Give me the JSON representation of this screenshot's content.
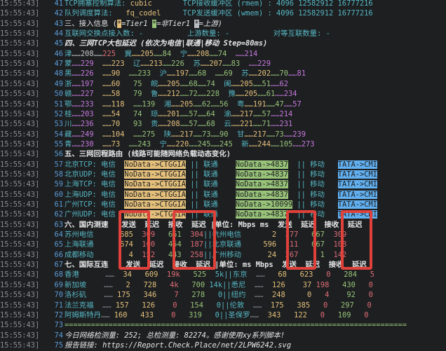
{
  "lines": [
    {
      "ts": "15:55:43]",
      "n": "41",
      "segs": [
        [
          "TCP拥塞控制算法: ",
          "cyan"
        ],
        [
          "cubic",
          "yellow"
        ],
        [
          "       TCP接收缓冲区 (rmem) : 4096 12582912 16777216",
          "cyan"
        ]
      ]
    },
    {
      "ts": "15:55:43]",
      "n": "42",
      "segs": [
        [
          "队列调度算法:   ",
          "cyan"
        ],
        [
          "fq_codel",
          "yellow"
        ],
        [
          "     TCP发送缓冲区 (wmem) : 4096 12582912 16777216",
          "cyan"
        ]
      ]
    },
    {
      "ts": "15:55:43]",
      "n": "43",
      "segs": [
        [
          "三、接入信息 (",
          "white"
        ],
        [
          "*",
          "bg-y"
        ],
        [
          "=Tier1 ",
          "white ital"
        ],
        [
          "*",
          "bg-g"
        ],
        [
          "=非Tier1 ",
          "white ital"
        ],
        [
          "*",
          "bg-gy"
        ],
        [
          "=上游)",
          "white ital"
        ]
      ]
    },
    {
      "ts": "15:55:43]",
      "n": "44",
      "segs": [
        [
          "互联网交换点接入数: -          上游数量: -          对等互联数量: -",
          "cyan"
        ]
      ]
    },
    {
      "ts": "15:55:43]",
      "n": "45",
      "segs": [
        [
          "四、三网TCP大包延迟 (依次为电信|联通|移动 Step=80ms)",
          "white bold ital"
        ]
      ]
    },
    {
      "ts": "15:55:43]",
      "n": "46",
      "segs": [
        [
          "津",
          "cyan"
        ],
        [
          "……",
          ""
        ],
        [
          "208",
          ""
        ],
        [
          "……",
          ""
        ],
        [
          "225",
          "red"
        ],
        [
          "  冀",
          "cyan"
        ],
        [
          "……205",
          "yellow"
        ],
        [
          "……84",
          "green"
        ],
        [
          "  宁",
          "cyan"
        ],
        [
          "……208",
          "yellow"
        ],
        [
          "……74",
          "green"
        ],
        [
          "  ……214",
          "magenta"
        ]
      ]
    },
    {
      "ts": "15:55:43]",
      "n": "47",
      "segs": [
        [
          "蒙",
          "cyan"
        ],
        [
          "……229",
          "magenta"
        ],
        [
          "  ……223",
          "yellow"
        ],
        [
          "  辽",
          "cyan"
        ],
        [
          "……213",
          "yellow"
        ],
        [
          "……226",
          "green"
        ],
        [
          "  苏",
          "cyan"
        ],
        [
          "……207",
          "yellow"
        ],
        [
          "……83",
          "green"
        ],
        [
          "  ……229",
          "magenta"
        ]
      ]
    },
    {
      "ts": "15:55:43]",
      "n": "48",
      "segs": [
        [
          "黑",
          "cyan"
        ],
        [
          "……226",
          "magenta"
        ],
        [
          "  ……90",
          "yellow"
        ],
        [
          "  ……233",
          "green"
        ],
        [
          "  沪",
          "cyan"
        ],
        [
          "……197",
          "yellow"
        ],
        [
          "……68",
          "green"
        ],
        [
          "  ……69",
          "green"
        ],
        [
          "  苏",
          "cyan"
        ],
        [
          "……202",
          "yellow"
        ],
        [
          "……70",
          "green"
        ],
        [
          "……81",
          "magenta"
        ]
      ]
    },
    {
      "ts": "15:55:43]",
      "n": "49",
      "segs": [
        [
          "浙",
          "cyan"
        ],
        [
          "……197",
          "magenta"
        ],
        [
          "  ……60",
          "yellow"
        ],
        [
          "   75",
          "green"
        ],
        [
          "  皖",
          "cyan"
        ],
        [
          "……205",
          "yellow"
        ],
        [
          "……68",
          "green"
        ],
        [
          "……74",
          "green"
        ],
        [
          "  闽",
          "cyan"
        ],
        [
          "……205",
          "yellow"
        ],
        [
          "……51",
          "green"
        ],
        [
          "……62",
          "magenta"
        ]
      ]
    },
    {
      "ts": "15:55:43]",
      "n": "50",
      "segs": [
        [
          "赣",
          "cyan"
        ],
        [
          "……227",
          "magenta"
        ],
        [
          "  ……58",
          "yellow"
        ],
        [
          "   79",
          "green"
        ],
        [
          "  鲁",
          "cyan"
        ],
        [
          "……212",
          "yellow"
        ],
        [
          "……72",
          "green"
        ],
        [
          "……228",
          "green"
        ],
        [
          "  豫",
          "cyan"
        ],
        [
          "……205",
          "yellow"
        ],
        [
          "……61",
          "green"
        ],
        [
          "……234",
          "magenta"
        ]
      ]
    },
    {
      "ts": "15:55:43]",
      "n": "51",
      "segs": [
        [
          "鄂",
          "cyan"
        ],
        [
          "……233",
          "magenta"
        ],
        [
          "  ……118",
          "yellow"
        ],
        [
          "  ……139",
          "green"
        ],
        [
          "  湘",
          "cyan"
        ],
        [
          "……205",
          "yellow"
        ],
        [
          "……62",
          "green"
        ],
        [
          "……56",
          "green"
        ],
        [
          "  粤",
          "cyan"
        ],
        [
          "……191",
          "yellow"
        ],
        [
          "……47",
          "green"
        ],
        [
          "……57",
          "magenta"
        ]
      ]
    },
    {
      "ts": "15:55:43]",
      "n": "52",
      "segs": [
        [
          "桂",
          "cyan"
        ],
        [
          "……203",
          "magenta"
        ],
        [
          "  ……54",
          "yellow"
        ],
        [
          "   74",
          "green"
        ],
        [
          "  琼",
          "cyan"
        ],
        [
          "……201",
          "yellow"
        ],
        [
          "……57",
          "green"
        ],
        [
          "……64",
          "green"
        ],
        [
          "  渝",
          "cyan"
        ],
        [
          "……217",
          "yellow"
        ],
        [
          "……57",
          "green"
        ],
        [
          "……214",
          "magenta"
        ]
      ]
    },
    {
      "ts": "15:55:43]",
      "n": "53",
      "segs": [
        [
          "川",
          "cyan"
        ],
        [
          "……236",
          "magenta"
        ],
        [
          "  ……70",
          "yellow"
        ],
        [
          "   93",
          "green"
        ],
        [
          "  贵",
          "cyan"
        ],
        [
          "……208",
          "yellow"
        ],
        [
          "……57",
          "green"
        ],
        [
          "……68",
          "green"
        ],
        [
          "  云",
          "cyan"
        ],
        [
          "……221",
          "yellow"
        ],
        [
          "……71",
          "green"
        ],
        [
          "……231",
          "magenta"
        ]
      ]
    },
    {
      "ts": "15:55:43]",
      "n": "54",
      "segs": [
        [
          "藏",
          "cyan"
        ],
        [
          "……249",
          "magenta"
        ],
        [
          "  ……104",
          "yellow"
        ],
        [
          "  ……275",
          "green"
        ],
        [
          "  陕",
          "cyan"
        ],
        [
          "……217",
          "yellow"
        ],
        [
          "……73",
          "green"
        ],
        [
          "……90",
          "green"
        ],
        [
          "  甘",
          "cyan"
        ],
        [
          "……217",
          "yellow"
        ],
        [
          "……73",
          "green"
        ],
        [
          "……239",
          "magenta"
        ]
      ]
    },
    {
      "ts": "15:55:43]",
      "n": "55",
      "segs": [
        [
          "青",
          "cyan"
        ],
        [
          "……230",
          "magenta"
        ],
        [
          "  ……73",
          "yellow"
        ],
        [
          "  ……243",
          "green"
        ],
        [
          "  宁",
          "cyan"
        ],
        [
          "……220",
          "yellow"
        ],
        [
          "……245",
          "green"
        ],
        [
          "……245",
          "green"
        ],
        [
          "  新",
          "cyan"
        ],
        [
          "……244",
          "yellow"
        ],
        [
          "……105",
          "green"
        ],
        [
          "……273",
          "magenta"
        ]
      ]
    },
    {
      "ts": "15:55:43]",
      "n": "56",
      "segs": [
        [
          "五、三网回程路由 (线路可能随网络负载动态变化)",
          "white bold"
        ]
      ]
    },
    {
      "ts": "15:55:43]",
      "n": "57",
      "segs": [
        [
          "北京TCP: 电信  ",
          "cyan"
        ],
        [
          "NoData->CTGGIA",
          "bg-y"
        ],
        [
          " || 联通    ",
          "cyan"
        ],
        [
          "NoData->4837",
          "bg-g"
        ],
        [
          "  || 移动   ",
          "cyan"
        ],
        [
          "TATA->CMI",
          "bg-b"
        ]
      ]
    },
    {
      "ts": "15:55:43]",
      "n": "58",
      "segs": [
        [
          "北京UDP: 电信  ",
          "cyan"
        ],
        [
          "NoData->CTGGIA",
          "bg-y"
        ],
        [
          " || 联通    ",
          "cyan"
        ],
        [
          "NoData->4837",
          "bg-g"
        ],
        [
          "  || 移动   ",
          "cyan"
        ],
        [
          "TATA->CMI",
          "bg-b"
        ]
      ]
    },
    {
      "ts": "15:55:43]",
      "n": "59",
      "segs": [
        [
          "上海TCP: 电信  ",
          "cyan"
        ],
        [
          "NoData->CTGGIA",
          "bg-y"
        ],
        [
          " || 联通    ",
          "cyan"
        ],
        [
          "NoData->4837",
          "bg-g"
        ],
        [
          "  || 移动   ",
          "cyan"
        ],
        [
          "TATA->CMI",
          "bg-b"
        ]
      ]
    },
    {
      "ts": "15:55:43]",
      "n": "60",
      "segs": [
        [
          "上海UDP: 电信  ",
          "cyan"
        ],
        [
          "NoData->CTGGIA",
          "bg-y"
        ],
        [
          " || 联通    ",
          "cyan"
        ],
        [
          "NoData->4837",
          "bg-g"
        ],
        [
          "  || 移动   ",
          "cyan"
        ],
        [
          "TATA->CMI",
          "bg-b"
        ]
      ]
    },
    {
      "ts": "15:55:43]",
      "n": "61",
      "segs": [
        [
          "广州TCP: 电信  ",
          "cyan"
        ],
        [
          "NoData->CTGGIA",
          "bg-y"
        ],
        [
          " || 联通    ",
          "cyan"
        ],
        [
          "NoData->10099",
          "bg-g"
        ],
        [
          " || 移动   ",
          "cyan"
        ],
        [
          "TATA->CMI",
          "bg-b"
        ]
      ]
    },
    {
      "ts": "15:55:43]",
      "n": "62",
      "segs": [
        [
          "广州UDP: 电信  ",
          "cyan"
        ],
        [
          "NoData->CTGGIA",
          "bg-y"
        ],
        [
          " || 联通    ",
          "cyan"
        ],
        [
          "NoData->4837",
          "bg-g"
        ],
        [
          "  || 移动   ",
          "cyan"
        ],
        [
          "TATA->CMI",
          "bg-b"
        ]
      ]
    },
    {
      "ts": "15:55:43]",
      "n": "63",
      "segs": [
        [
          "六、国内测速   发送  延迟  接收  延迟 |单位: Mbps ms  发送  延迟  接收  延迟",
          "white bold"
        ]
      ]
    },
    {
      "ts": "15:55:43]",
      "n": "64",
      "segs": [
        [
          "苏州电信      ",
          "cyan"
        ],
        [
          "685",
          "yellow"
        ],
        [
          "  309",
          "red"
        ],
        [
          "   651",
          "green"
        ],
        [
          "  304",
          "red"
        ],
        [
          "||杭州电信",
          "cyan"
        ],
        [
          "       2",
          "yellow"
        ],
        [
          "  377",
          "red"
        ],
        [
          "   667",
          "green"
        ],
        [
          "  309",
          "red"
        ]
      ]
    },
    {
      "ts": "15:55:43]",
      "n": "65",
      "segs": [
        [
          "上海联通      ",
          "cyan"
        ],
        [
          "674",
          "yellow"
        ],
        [
          "  100",
          "red"
        ],
        [
          "   454",
          "green"
        ],
        [
          "  187",
          "red"
        ],
        [
          "||北京联通",
          "cyan"
        ],
        [
          "     596",
          "yellow"
        ],
        [
          "  111",
          "red"
        ],
        [
          "   667",
          "green"
        ],
        [
          "  108",
          "red"
        ]
      ]
    },
    {
      "ts": "15:55:43]",
      "n": "66",
      "segs": [
        [
          "成都移动        ",
          "cyan"
        ],
        [
          "4",
          "yellow"
        ],
        [
          "  152",
          "red"
        ],
        [
          "   443",
          "green"
        ],
        [
          "  258",
          "red"
        ],
        [
          "||广州移动",
          "cyan"
        ],
        [
          "      24",
          "yellow"
        ],
        [
          "  267",
          "red"
        ],
        [
          "     1",
          "green"
        ],
        [
          "  142",
          "red"
        ]
      ]
    },
    {
      "ts": "15:55:43]",
      "n": "67",
      "segs": [
        [
          "七、国际互连    发送  延迟  接收  延迟 |单位: ms Mbps  发送  延迟  接收  延迟",
          "white bold"
        ]
      ]
    },
    {
      "ts": "15:55:43]",
      "n": "68",
      "segs": [
        [
          "香港      ",
          "cyan"
        ],
        [
          "……",
          "gray"
        ],
        [
          "  34",
          "yellow"
        ],
        [
          "   609",
          "yellow"
        ],
        [
          "  19k",
          "red"
        ],
        [
          "   525",
          "green"
        ],
        [
          "  5k||东京",
          "cyan"
        ],
        [
          "  ……",
          "gray"
        ],
        [
          "   68",
          "yellow"
        ],
        [
          "   623",
          "yellow"
        ],
        [
          "   0",
          "red"
        ],
        [
          "   284",
          "green"
        ],
        [
          "   5",
          "red"
        ]
      ]
    },
    {
      "ts": "15:55:43]",
      "n": "69",
      "segs": [
        [
          "新加坡    ",
          "cyan"
        ],
        [
          "……",
          "gray"
        ],
        [
          "   2",
          "yellow"
        ],
        [
          "   728",
          "yellow"
        ],
        [
          "   4k",
          "red"
        ],
        [
          "   700",
          "green"
        ],
        [
          " 14k||悉尼",
          "cyan"
        ],
        [
          "  ……",
          "gray"
        ],
        [
          "  126",
          "yellow"
        ],
        [
          "    37",
          "yellow"
        ],
        [
          " 198",
          "red"
        ],
        [
          "   430",
          "green"
        ],
        [
          "   0",
          "red"
        ]
      ]
    },
    {
      "ts": "15:55:43]",
      "n": "70",
      "segs": [
        [
          "洛杉矶    ",
          "cyan"
        ],
        [
          "……",
          "gray"
        ],
        [
          " 175",
          "yellow"
        ],
        [
          "   346",
          "yellow"
        ],
        [
          "    7",
          "red"
        ],
        [
          "   278",
          "green"
        ],
        [
          "   0||纽约",
          "cyan"
        ],
        [
          "  ……",
          "gray"
        ],
        [
          "  248",
          "yellow"
        ],
        [
          "     0",
          "yellow"
        ],
        [
          "   4",
          "red"
        ],
        [
          "    92",
          "green"
        ],
        [
          "   0",
          "red"
        ]
      ]
    },
    {
      "ts": "15:55:43]",
      "n": "71",
      "segs": [
        [
          "法兰克福  ",
          "cyan"
        ],
        [
          "……",
          "gray"
        ],
        [
          " 157",
          "yellow"
        ],
        [
          "   126",
          "yellow"
        ],
        [
          "    0",
          "red"
        ],
        [
          "   154",
          "green"
        ],
        [
          "   0||伦敦",
          "cyan"
        ],
        [
          "  ……",
          "gray"
        ],
        [
          "  175",
          "yellow"
        ],
        [
          "   385",
          "yellow"
        ],
        [
          "   0",
          "red"
        ],
        [
          "   297",
          "green"
        ],
        [
          "   0",
          "red"
        ]
      ]
    },
    {
      "ts": "15:55:43]",
      "n": "72",
      "segs": [
        [
          "阿姆斯特丹",
          "cyan"
        ],
        [
          "……",
          "gray"
        ],
        [
          " 160",
          "yellow"
        ],
        [
          "   433",
          "yellow"
        ],
        [
          "    0",
          "red"
        ],
        [
          "   319",
          "green"
        ],
        [
          "   0||圣保罗",
          "cyan"
        ],
        [
          "……",
          "gray"
        ],
        [
          "  343",
          "yellow"
        ],
        [
          "   122",
          "yellow"
        ],
        [
          "   0",
          "red"
        ],
        [
          "   109",
          "green"
        ],
        [
          "   0",
          "red"
        ]
      ]
    },
    {
      "ts": "15:55:43]",
      "n": "73",
      "segs": [
        [
          "==============================================================================",
          "green"
        ]
      ]
    },
    {
      "ts": "15:55:43]",
      "n": "74",
      "segs": [
        [
          "今日网络检测量: 252; 总检测量: 82274。感谢使用xy系列脚本!",
          "white ital"
        ]
      ]
    },
    {
      "ts": "15:55:43]",
      "n": "75",
      "segs": [
        [
          "报告链接: https://Report.Check.Place/net/2LPW6242.svg",
          "white ital"
        ]
      ]
    }
  ],
  "highlights": [
    "发送",
    "接收",
    "发送",
    "接收"
  ]
}
